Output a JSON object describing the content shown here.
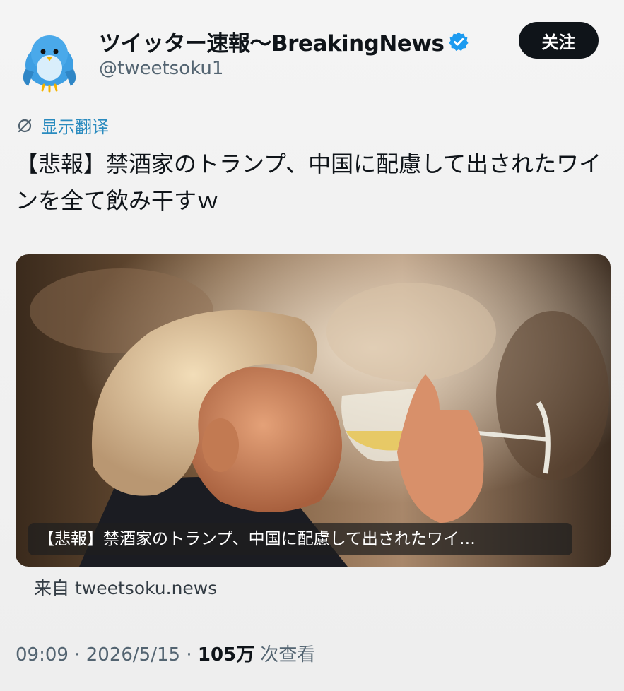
{
  "header": {
    "display_name": "ツイッター速報〜BreakingNews",
    "handle": "@tweetsoku1",
    "follow_label": "关注"
  },
  "translate_label": "显示翻译",
  "tweet": {
    "text": "【悲報】禁酒家のトランプ、中国に配慮して出されたワインを全て飲み干すｗ"
  },
  "card": {
    "caption": "【悲報】禁酒家のトランプ、中国に配慮して出されたワイ…",
    "source": "来自 tweetsoku.news"
  },
  "meta": {
    "time": "09:09",
    "date": "2026/5/15",
    "views": "105万",
    "views_label": "次查看",
    "separator": "·"
  },
  "colors": {
    "accent": "#1d9bf0",
    "follow_bg": "#0f1419",
    "avatar_bird": "#3e9fe3"
  },
  "icons": {
    "avatar": "blue-bird-icon",
    "verified": "verified-badge-icon",
    "translate": "translate-icon"
  }
}
